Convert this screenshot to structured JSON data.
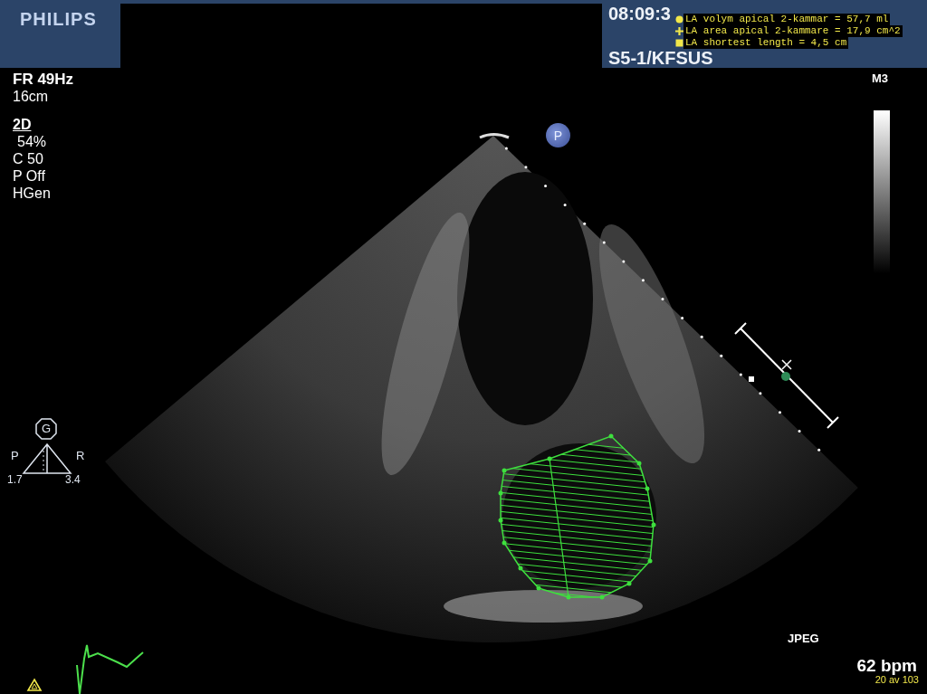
{
  "header": {
    "logo": "PHILIPS",
    "time": "08:09:3",
    "probe": "S5-1/KFSUS"
  },
  "measurements": [
    {
      "kind": "circle",
      "text": "LA volym apical 2-kammar = 57,7 ml"
    },
    {
      "kind": "plus",
      "text": "LA area apical 2-kammare = 17,9 cm^2"
    },
    {
      "kind": "square",
      "text": "LA shortest length = 4,5 cm"
    }
  ],
  "left_panel": {
    "frame_rate": "FR 49Hz",
    "depth": "16cm",
    "mode": "2D",
    "settings": [
      "54%",
      "C 50",
      "P Off",
      "HGen"
    ]
  },
  "orientation": {
    "badge": "G",
    "left": "P",
    "right": "R",
    "left_value": "1.7",
    "right_value": "3.4"
  },
  "marker": "P",
  "right_panel": {
    "map": "M3",
    "format": "JPEG",
    "heart_rate": "62 bpm",
    "frame": "20 av 103"
  }
}
